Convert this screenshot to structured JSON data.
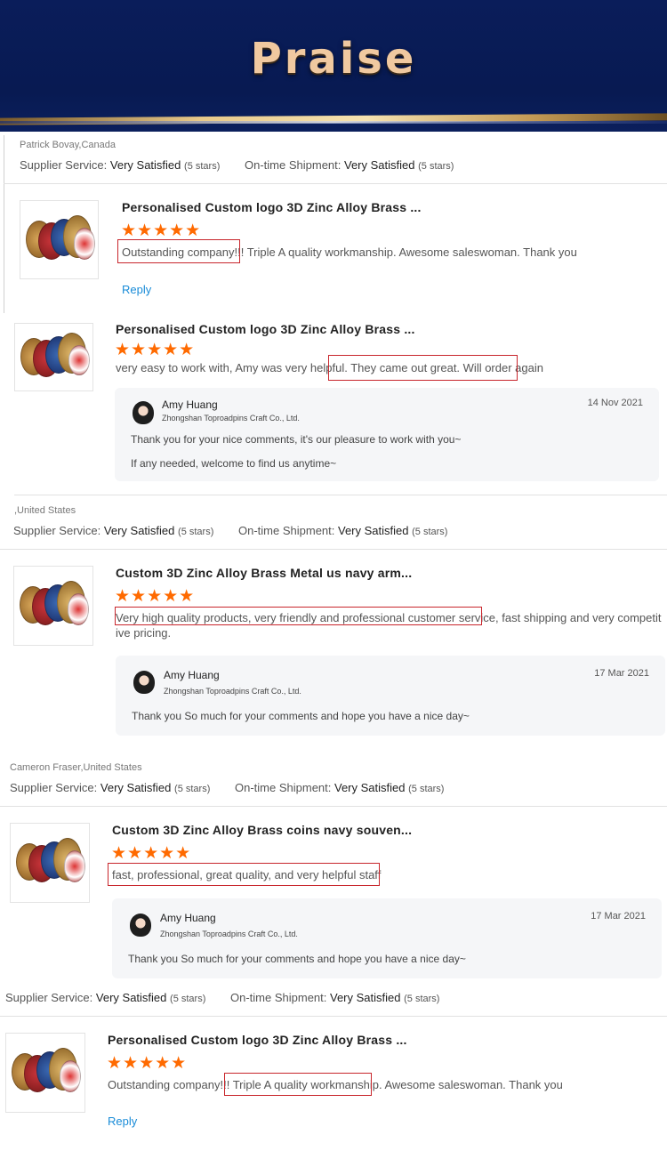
{
  "header": {
    "title": "Praise"
  },
  "labels": {
    "supplier_service": "Supplier Service:",
    "ontime_shipment": "On-time Shipment:",
    "very_satisfied": "Very Satisfied",
    "five_stars": "(5 stars)",
    "reply": "Reply",
    "star_glyphs": "★★★★★"
  },
  "colors": {
    "banner": "#0a1d5a",
    "title": "#f0c9a0",
    "stars": "#ff6a00",
    "link": "#1a8cd8",
    "highlight_box": "#c8262c"
  },
  "reviews": [
    {
      "reviewer": "Patrick Bovay,Canada",
      "product_title": "Personalised Custom logo 3D Zinc Alloy Brass ...",
      "rating": 5,
      "text_highlight": "Outstanding company!!!",
      "text_rest": " Triple A quality workmanship.  Awesome saleswoman.  Thank you"
    },
    {
      "product_title": "Personalised Custom logo 3D Zinc Alloy Brass ...",
      "rating": 5,
      "text_plain": "very easy to work with, Amy was very helpful.",
      "text_highlight": "They came out great. Will order again",
      "supplier_reply": {
        "name": "Amy Huang",
        "company": "Zhongshan Toproadpins Craft Co., Ltd.",
        "date": "14 Nov 2021",
        "line1": "Thank you for your nice comments, it's our pleasure to work with you~",
        "line2": "If any needed, welcome to find us anytime~"
      }
    },
    {
      "reviewer": ",United States",
      "product_title": "Custom 3D Zinc Alloy Brass Metal us navy arm...",
      "rating": 5,
      "text_highlight": "Very high quality products, very friendly and professional customer service,",
      "text_rest_line1": " fast shipping and very competit",
      "text_rest_line2": "ive pricing.",
      "supplier_reply": {
        "name": "Amy Huang",
        "company": "Zhongshan Toproadpins Craft Co., Ltd.",
        "date": "17 Mar 2021",
        "line1": "Thank you So much for your comments and hope you have a nice day~"
      }
    },
    {
      "reviewer": "Cameron Fraser,United States",
      "product_title": "Custom 3D Zinc Alloy Brass coins navy souven...",
      "rating": 5,
      "text_highlight": "fast, professional, great quality, and very helpful staff",
      "supplier_reply": {
        "name": "Amy Huang",
        "company": "Zhongshan Toproadpins Craft Co., Ltd.",
        "date": "17 Mar 2021",
        "line1": "Thank you So much for your comments and hope you have a nice day~"
      }
    },
    {
      "product_title": "Personalised Custom logo 3D Zinc Alloy Brass ...",
      "rating": 5,
      "text_plain": "Outstanding company!!!",
      "text_highlight": "Triple A quality workmanship.",
      "text_rest": " Awesome saleswoman.  Thank you"
    }
  ]
}
